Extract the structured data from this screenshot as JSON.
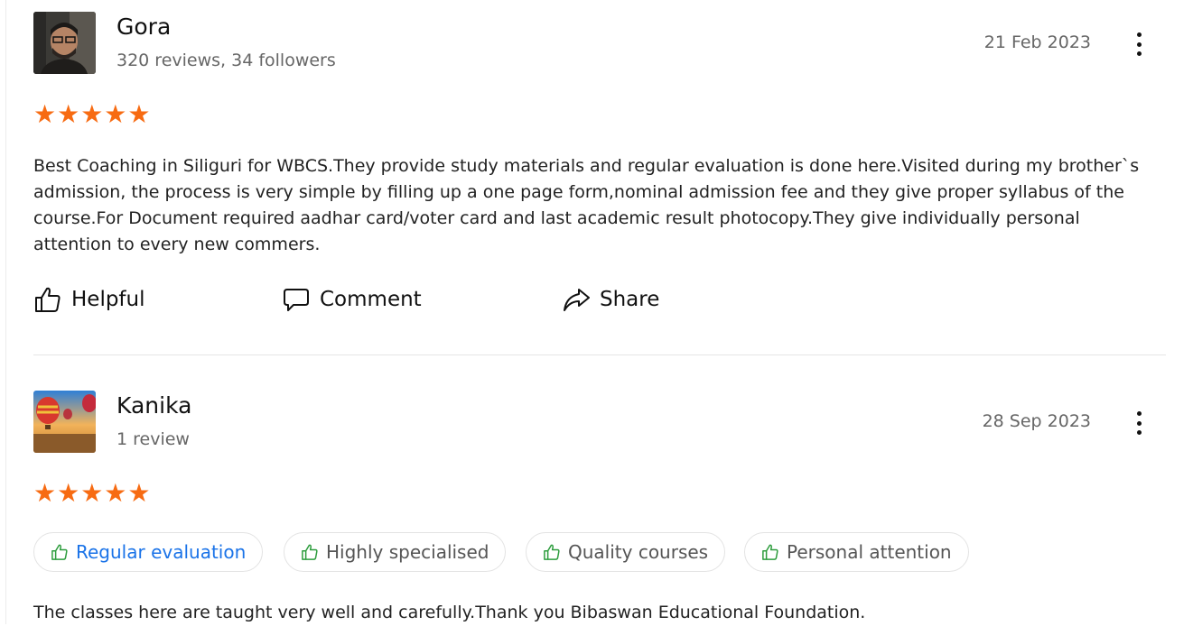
{
  "reviews": [
    {
      "name": "Gora",
      "meta": "320 reviews, 34 followers",
      "date": "21 Feb 2023",
      "stars": "★★★★★",
      "rating": 5,
      "text": "Best Coaching in Siliguri for WBCS.They provide study materials and regular evaluation is done here.Visited during my brother`s admission, the process is very simple by filling up a one page form,nominal admission fee and they give proper syllabus of the course.For Document required aadhar card/voter card and last academic result photocopy.They give individually personal attention to every new commers.",
      "actions": {
        "helpful": "Helpful",
        "comment": "Comment",
        "share": "Share"
      }
    },
    {
      "name": "Kanika",
      "meta": "1 review",
      "date": "28 Sep 2023",
      "stars": "★★★★★",
      "rating": 5,
      "tags": [
        "Regular evaluation",
        "Highly specialised",
        "Quality courses",
        "Personal attention"
      ],
      "text": "The classes here are taught very well and carefully.Thank you Bibaswan Educational Foundation."
    }
  ],
  "colors": {
    "star": "#f76b12",
    "tag_icon": "#2e9d3e",
    "tag_active_text": "#1a73e8"
  },
  "icons": {
    "helpful": "thumbs-up-icon",
    "comment": "speech-bubble-icon",
    "share": "share-arrow-icon",
    "menu": "more-vertical-icon"
  }
}
